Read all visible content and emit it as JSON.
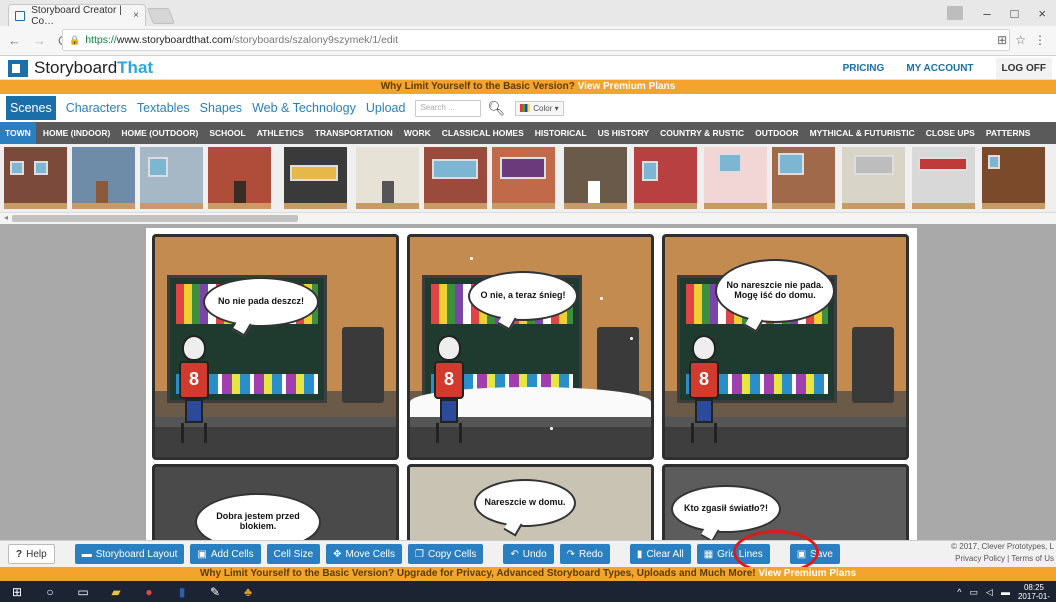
{
  "browser": {
    "tab_title": "Storyboard Creator | Co…",
    "tab_close": "×",
    "url_https": "https://",
    "url_host": "www.storyboardthat.com",
    "url_path": "/storyboards/szalony9szymek/1/edit",
    "window_controls": [
      "–",
      "□",
      "×"
    ]
  },
  "site": {
    "logo_part1": "Storyboard",
    "logo_part2": "That",
    "nav": [
      "PRICING",
      "MY ACCOUNT",
      "LOG OFF"
    ],
    "promo_top_text": "Why Limit Yourself to the Basic Version?",
    "promo_top_link": "View Premium Plans"
  },
  "library": {
    "tabs": [
      "Scenes",
      "Characters",
      "Textables",
      "Shapes",
      "Web & Technology",
      "Upload"
    ],
    "search_placeholder": "Search ...",
    "color_label": "Color ▾",
    "categories": [
      "TOWN",
      "HOME (INDOOR)",
      "HOME (OUTDOOR)",
      "SCHOOL",
      "ATHLETICS",
      "TRANSPORTATION",
      "WORK",
      "CLASSICAL HOMES",
      "HISTORICAL",
      "US HISTORY",
      "COUNTRY & RUSTIC",
      "OUTDOOR",
      "MYTHICAL & FUTURISTIC",
      "CLOSE UPS",
      "PATTERNS"
    ]
  },
  "storyboard": {
    "cells": [
      {
        "bubble": "No nie pada deszcz!",
        "shirt_number": "8"
      },
      {
        "bubble": "O nie, a teraz śnieg!",
        "shirt_number": "8"
      },
      {
        "bubble": "No nareszcie nie pada. Mogę iść do domu.",
        "shirt_number": "8"
      },
      {
        "bubble": "Dobra jestem przed blokiem."
      },
      {
        "bubble": "Nareszcie w domu."
      },
      {
        "bubble": "Kto zgasił światło?!"
      }
    ]
  },
  "toolbar": {
    "help": "Help",
    "help_icon": "?",
    "storyboard_layout": "Storyboard Layout",
    "add_cells": "Add Cells",
    "cell_size": "Cell Size",
    "move_cells": "Move Cells",
    "copy_cells": "Copy Cells",
    "undo": "Undo",
    "redo": "Redo",
    "clear_all": "Clear All",
    "grid_lines": "Grid Lines",
    "save": "Save",
    "copyright_line1": "© 2017, Clever Prototypes, L",
    "copyright_line2": "Privacy Policy | Terms of Us"
  },
  "promo_bottom": {
    "text": "Why Limit Yourself to the Basic Version? Upgrade for Privacy, Advanced Storyboard Types, Uploads and Much More!",
    "link": "View Premium Plans"
  },
  "taskbar": {
    "clock_time": "08:25",
    "clock_date": "2017-01-"
  },
  "colors": {
    "brand_blue": "#2a7fc0",
    "promo_orange": "#f4a32d",
    "highlight_red": "#e01a1a"
  }
}
